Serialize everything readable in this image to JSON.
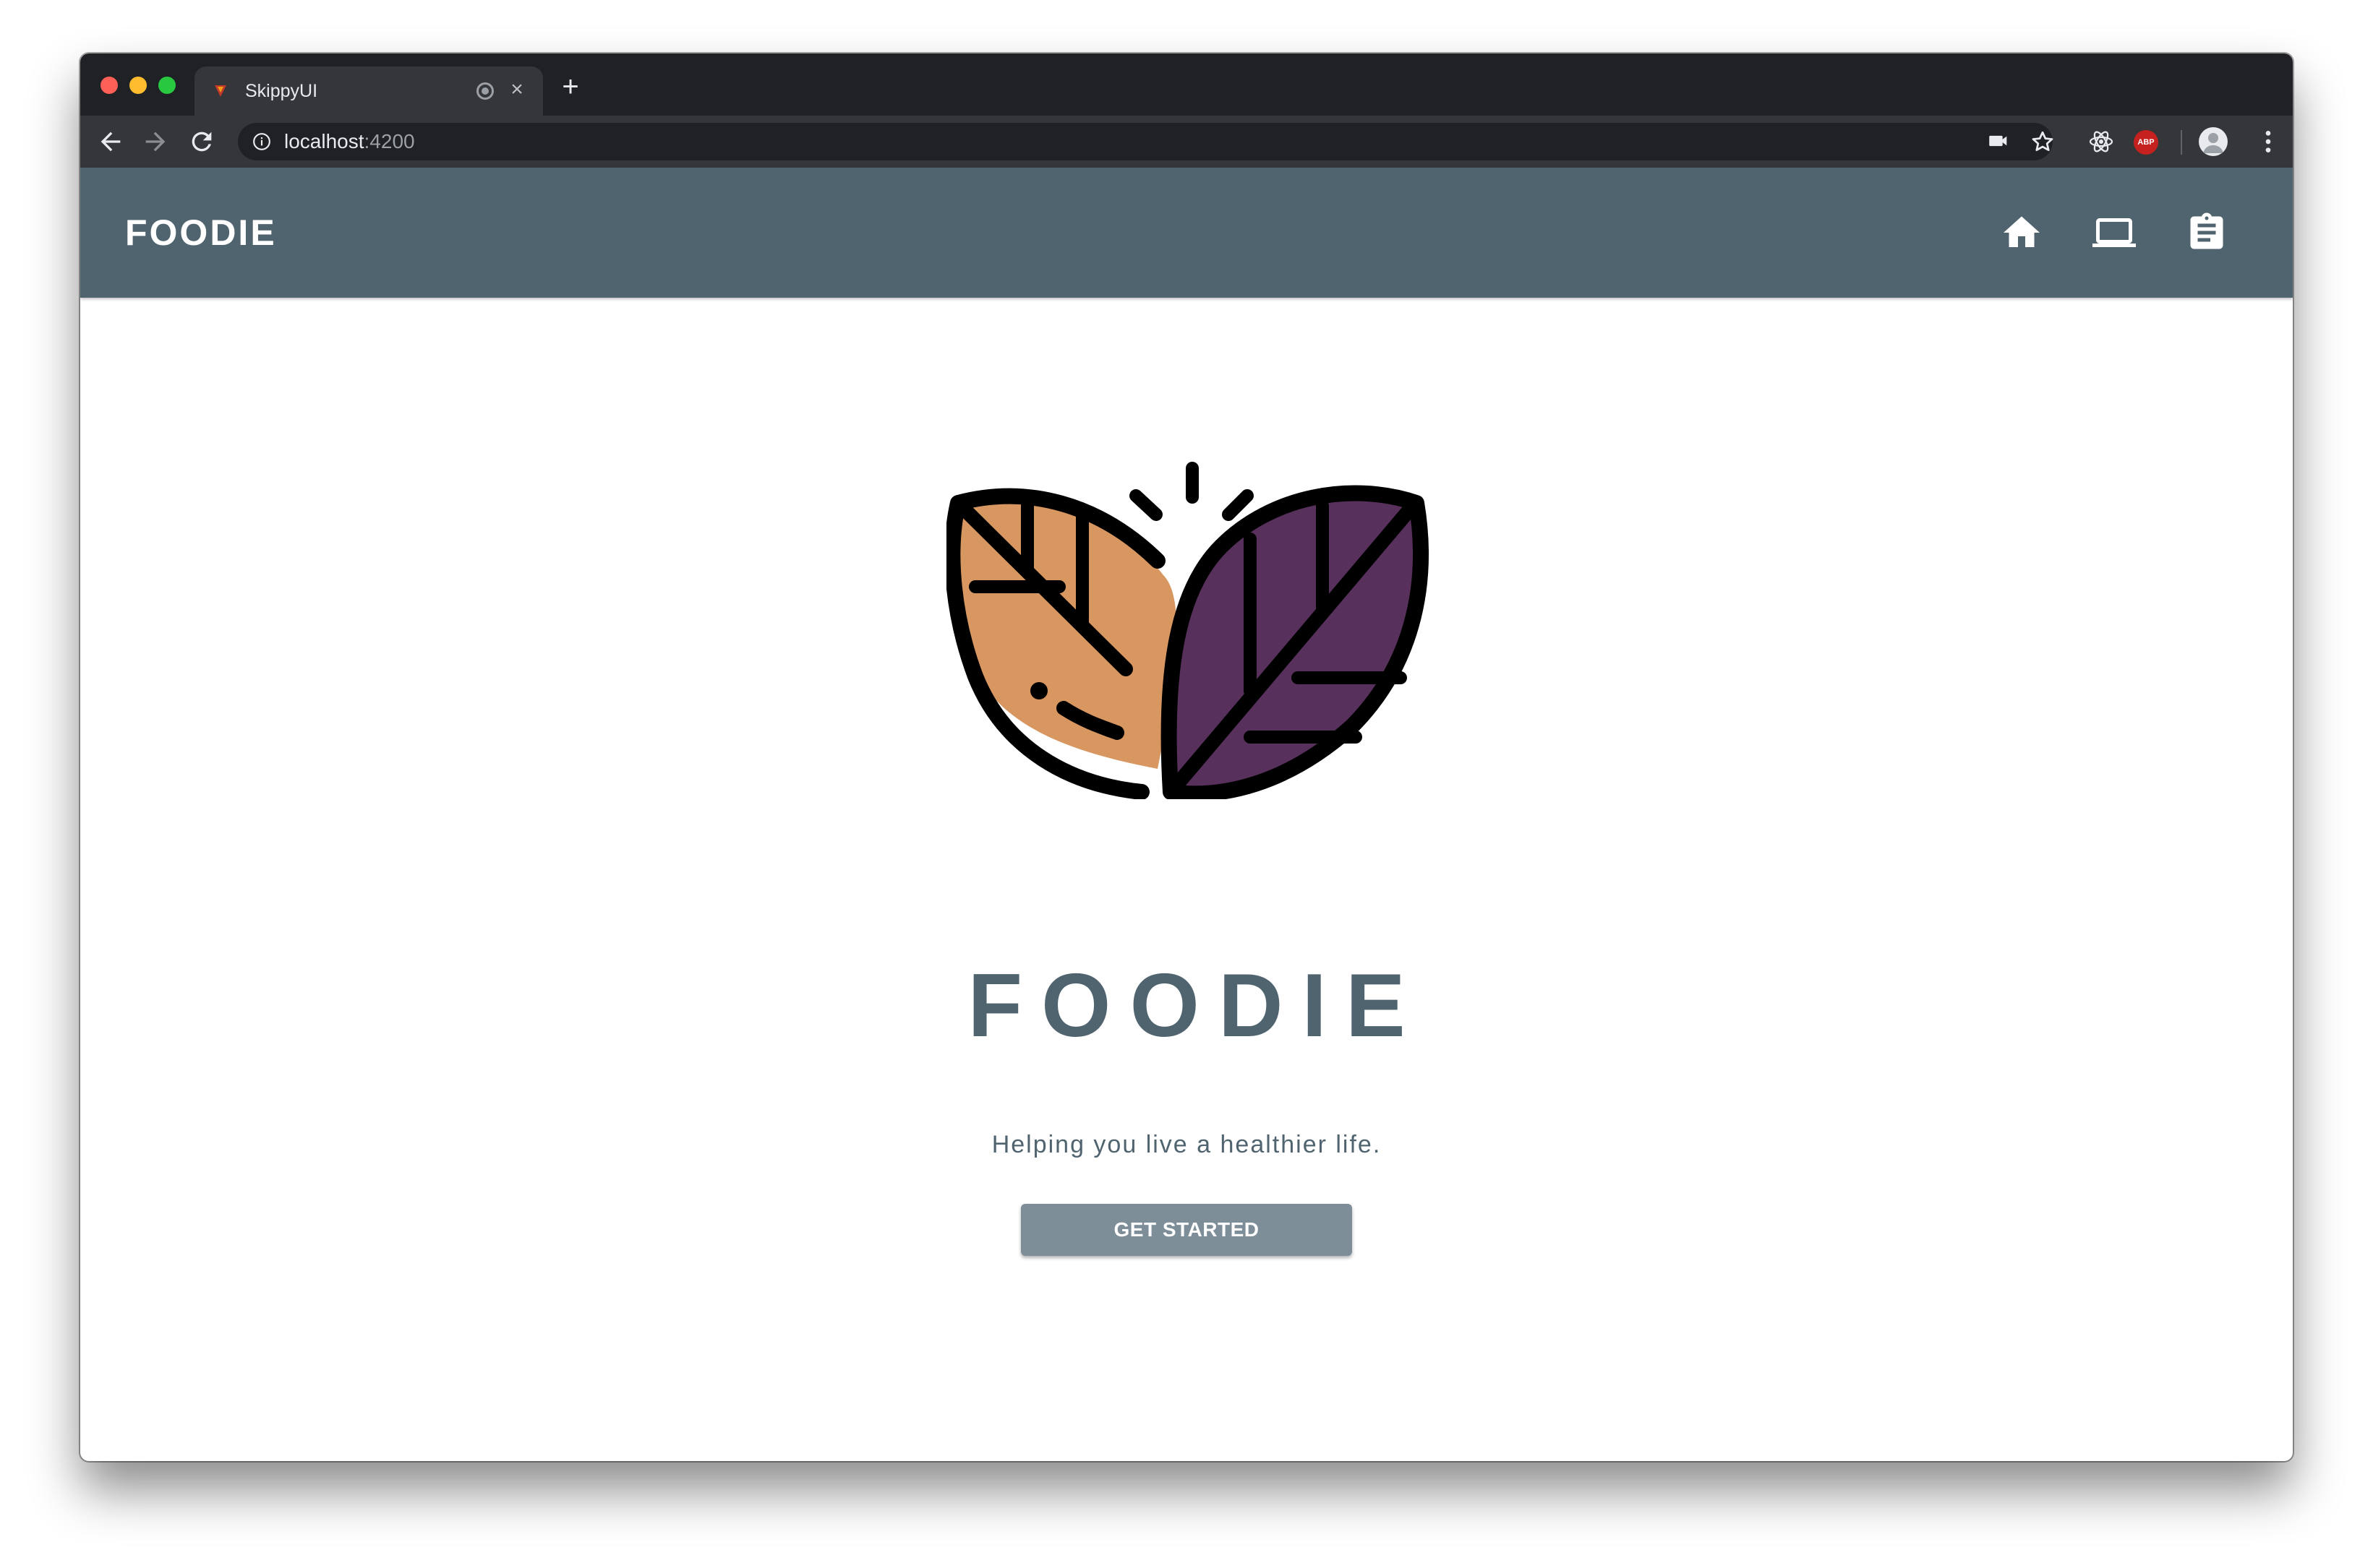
{
  "browser": {
    "tab": {
      "title": "SkippyUI"
    },
    "new_tab_symbol": "+",
    "close_symbol": "×",
    "address": {
      "host": "localhost",
      "port": ":4200"
    },
    "extension_abp_label": "ABP"
  },
  "app": {
    "brand": "FOODIE",
    "nav": [
      {
        "icon": "home-icon"
      },
      {
        "icon": "laptop-icon"
      },
      {
        "icon": "clipboard-icon"
      }
    ]
  },
  "hero": {
    "logo_icon": "leaves-logo-icon",
    "title": "FOODIE",
    "tagline": "Helping you live a healthier life.",
    "cta_label": "GET STARTED"
  },
  "colors": {
    "appbar": "#506470",
    "cta": "#7e8e99",
    "leaf_orange": "#d89760",
    "leaf_purple": "#57305b"
  }
}
